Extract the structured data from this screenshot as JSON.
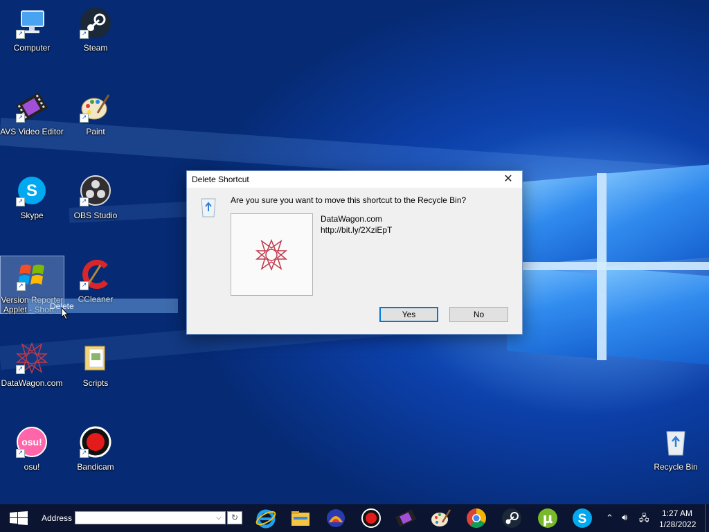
{
  "desktop": {
    "icons": [
      {
        "label": "Computer"
      },
      {
        "label": "Steam"
      },
      {
        "label": "AVS Video Editor"
      },
      {
        "label": "Paint"
      },
      {
        "label": "Skype"
      },
      {
        "label": "OBS Studio"
      },
      {
        "label_line1": "Version Reporter",
        "label_line2": "Applet - Short..."
      },
      {
        "label": "CCleaner"
      },
      {
        "label": "DataWagon.com"
      },
      {
        "label": "Scripts"
      },
      {
        "label": "osu!",
        "badge": "osu!"
      },
      {
        "label": "Bandicam"
      },
      {
        "label": "Recycle Bin"
      }
    ],
    "context_hint": "Delete",
    "shortcut_arrow": "↗"
  },
  "dialog": {
    "title": "Delete Shortcut",
    "close": "✕",
    "message": "Are you sure you want to move this shortcut to the Recycle Bin?",
    "item_name": "DataWagon.com",
    "item_target": "http://bit.ly/2XziEpT",
    "yes_label": "Yes",
    "no_label": "No"
  },
  "taskbar": {
    "address_label": "Address",
    "address_value": "",
    "dropdown_glyph": "⌵",
    "go_glyph": "↻",
    "apps": [
      "internet-explorer",
      "file-explorer",
      "avs-player",
      "bandicam",
      "avs-video-editor",
      "paint",
      "chrome",
      "steam",
      "utorrent",
      "skype"
    ],
    "utorrent_letter": "µ",
    "skype_letter": "S",
    "tray": {
      "chevron": "⌃",
      "volume": "🔊︎",
      "network": "🖧"
    },
    "time": "1:27 AM",
    "date": "1/28/2022"
  },
  "colors": {
    "accent": "#0078d7",
    "taskbar_bg": "#0b1430",
    "dialog_bg": "#f0f0f0"
  }
}
